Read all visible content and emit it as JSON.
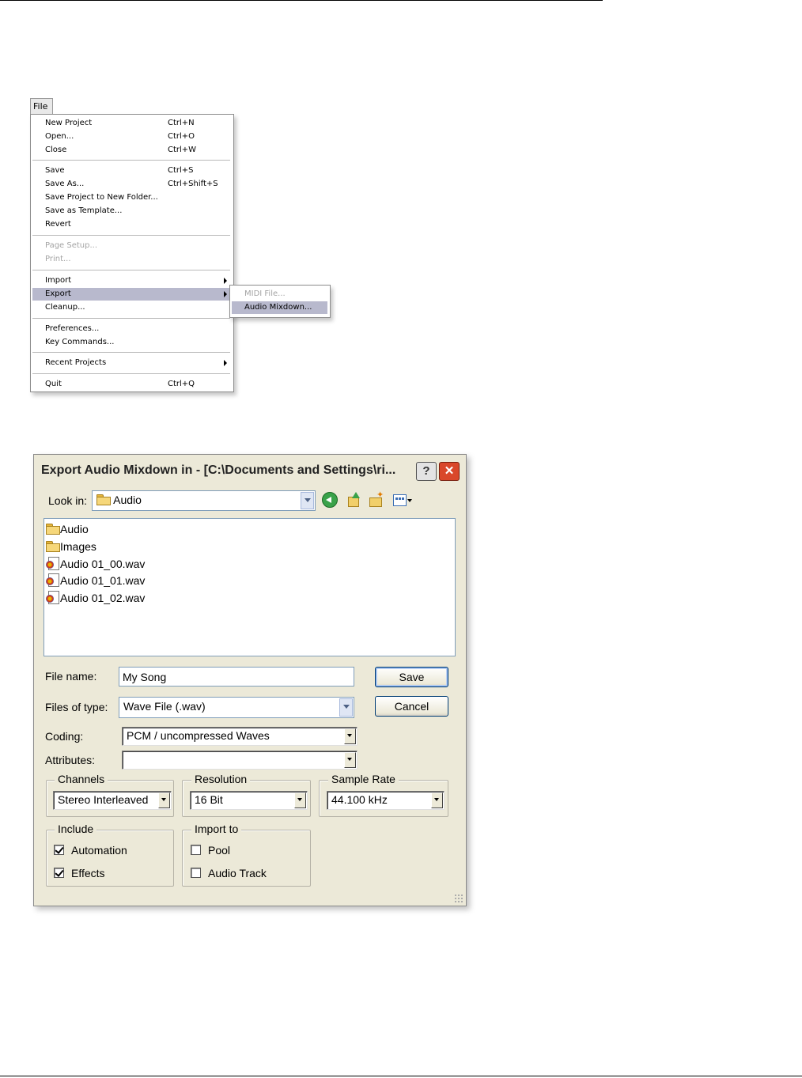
{
  "file_menu": {
    "title": "File",
    "items": [
      {
        "label": "New Project",
        "shortcut": "Ctrl+N"
      },
      {
        "label": "Open...",
        "shortcut": "Ctrl+O"
      },
      {
        "label": "Close",
        "shortcut": "Ctrl+W"
      },
      {
        "label": "Save",
        "shortcut": "Ctrl+S"
      },
      {
        "label": "Save As...",
        "shortcut": "Ctrl+Shift+S"
      },
      {
        "label": "Save Project to New Folder...",
        "shortcut": ""
      },
      {
        "label": "Save as Template...",
        "shortcut": ""
      },
      {
        "label": "Revert",
        "shortcut": ""
      },
      {
        "label": "Page Setup...",
        "shortcut": "",
        "disabled": true
      },
      {
        "label": "Print...",
        "shortcut": "",
        "disabled": true
      },
      {
        "label": "Import",
        "shortcut": "",
        "submenu": true
      },
      {
        "label": "Export",
        "shortcut": "",
        "submenu": true,
        "highlighted": true
      },
      {
        "label": "Cleanup...",
        "shortcut": ""
      },
      {
        "label": "Preferences...",
        "shortcut": ""
      },
      {
        "label": "Key Commands...",
        "shortcut": ""
      },
      {
        "label": "Recent Projects",
        "shortcut": "",
        "submenu": true
      },
      {
        "label": "Quit",
        "shortcut": "Ctrl+Q"
      }
    ]
  },
  "export_submenu": {
    "items": [
      {
        "label": "MIDI File...",
        "disabled": true
      },
      {
        "label": "Audio Mixdown...",
        "highlighted": true
      }
    ]
  },
  "dialog": {
    "title": "Export Audio Mixdown in - [C:\\Documents and Settings\\ri...",
    "help_label": "?",
    "close_label": "✕",
    "look_in_label": "Look in:",
    "look_in_value": "Audio",
    "files": [
      {
        "name": "Audio",
        "icon": "folder-icon"
      },
      {
        "name": "Images",
        "icon": "folder-icon"
      },
      {
        "name": "Audio 01_00.wav",
        "icon": "wav-file-icon"
      },
      {
        "name": "Audio 01_01.wav",
        "icon": "wav-file-icon"
      },
      {
        "name": "Audio 01_02.wav",
        "icon": "wav-file-icon"
      }
    ],
    "file_name_label": "File name:",
    "file_name_value": "My Song",
    "file_type_label": "Files of type:",
    "file_type_value": "Wave File (.wav)",
    "save_label": "Save",
    "cancel_label": "Cancel",
    "coding_label": "Coding:",
    "coding_value": "PCM / uncompressed Waves",
    "attributes_label": "Attributes:",
    "attributes_value": "",
    "channels_label": "Channels",
    "channels_value": "Stereo Interleaved",
    "resolution_label": "Resolution",
    "resolution_value": "16 Bit",
    "sample_rate_label": "Sample Rate",
    "sample_rate_value": "44.100 kHz",
    "include_label": "Include",
    "automation_label": "Automation",
    "automation_checked": true,
    "effects_label": "Effects",
    "effects_checked": true,
    "import_to_label": "Import to",
    "pool_label": "Pool",
    "pool_checked": false,
    "audio_track_label": "Audio Track",
    "audio_track_checked": false
  },
  "colors": {
    "menu_highlight": "#b8b9cd",
    "dialog_face": "#ece9d8",
    "close_button": "#d9472a"
  }
}
